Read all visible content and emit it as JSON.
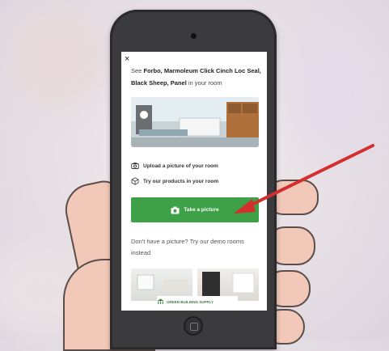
{
  "dialog": {
    "close_symbol": "×",
    "intro_prefix": "See ",
    "product_name": "Forbo, Marmoleum Click Cinch Loc Seal, Black Sheep, Panel",
    "intro_suffix": " in your room"
  },
  "features": {
    "upload_label": "Upload a picture of your room",
    "upload_icon": "camera-icon",
    "try_label": "Try our products in your room",
    "try_icon": "cube-icon"
  },
  "cta": {
    "label": "Take a picture",
    "icon": "camera-icon",
    "color": "#3ea047"
  },
  "demo": {
    "prompt": "Don't have a picture? Try our demo rooms instead"
  },
  "footer": {
    "brand_text": "GREEN BUILDING SUPPLY"
  },
  "annotation": {
    "arrow_color": "#d32f2f"
  }
}
